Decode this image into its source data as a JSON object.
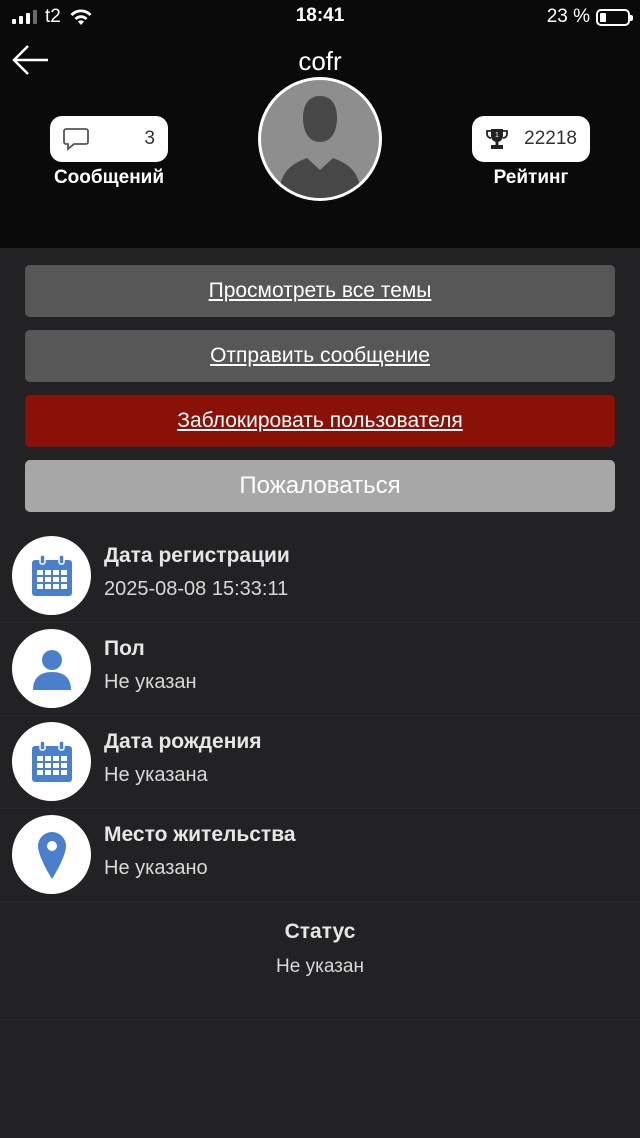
{
  "status_bar": {
    "carrier": "t2",
    "time": "18:41",
    "battery_percent": "23 %",
    "battery_level": 0.23
  },
  "profile": {
    "username": "cofr",
    "messages_count": "3",
    "messages_label": "Сообщений",
    "rating_value": "22218",
    "rating_label": "Рейтинг"
  },
  "actions": {
    "view_topics": "Просмотреть все темы",
    "send_message": "Отправить сообщение",
    "block_user": "Заблокировать пользователя",
    "report": "Пожаловаться"
  },
  "info": [
    {
      "title": "Дата регистрации",
      "value": "2025-08-08 15:33:11",
      "icon": "calendar-icon"
    },
    {
      "title": "Пол",
      "value": "Не указан",
      "icon": "person-icon"
    },
    {
      "title": "Дата рождения",
      "value": "Не указана",
      "icon": "calendar-icon"
    },
    {
      "title": "Место жительства",
      "value": "Не указано",
      "icon": "location-pin-icon"
    }
  ],
  "status": {
    "title": "Статус",
    "value": "Не указан"
  },
  "colors": {
    "background": "#222224",
    "header": "#0a0a0a",
    "button_gray": "#575757",
    "button_danger": "#8a1108",
    "button_light": "#a7a7a7",
    "icon_blue": "#4a7fcb"
  }
}
